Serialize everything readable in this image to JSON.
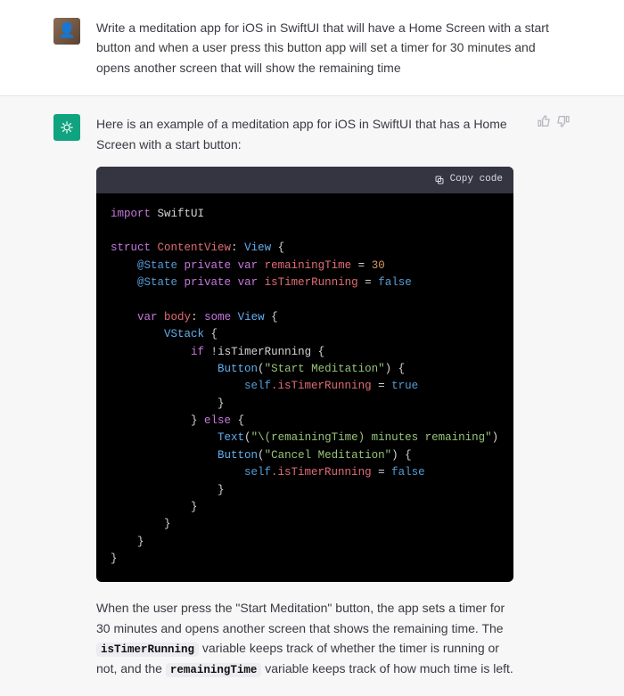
{
  "user": {
    "prompt": "Write a meditation app for iOS in SwiftUI that will have a Home Screen with a start button and when a user press this button app will set a timer for 30 minutes and opens another screen that will show the remaining time"
  },
  "assistant": {
    "intro": "Here is an example of a meditation app for iOS in SwiftUI that has a Home Screen with a start button:",
    "code_header": {
      "copy_label": "Copy code"
    },
    "code": {
      "kw_import": "import",
      "mod_swiftui": "SwiftUI",
      "kw_struct": "struct",
      "type_contentview": "ContentView",
      "type_view": "View",
      "attr_state": "@State",
      "kw_private": "private",
      "kw_var": "var",
      "var_remaining": "remainingTime",
      "num_30": "30",
      "var_running": "isTimerRunning",
      "bool_false": "false",
      "bool_true": "true",
      "var_body": "body",
      "kw_some": "some",
      "type_vstack": "VStack",
      "kw_if": "if",
      "kw_else": "else",
      "type_button": "Button",
      "str_start": "\"Start Meditation\"",
      "str_cancel": "\"Cancel Meditation\"",
      "type_text": "Text",
      "str_remaining": "\"\\(remainingTime) minutes remaining\"",
      "kw_self": "self",
      "dot_running": ".isTimerRunning"
    },
    "outro": {
      "p1a": "When the user press the \"Start Meditation\" button, the app sets a timer for 30 minutes and opens another screen that shows the remaining time. The ",
      "c1": "isTimerRunning",
      "p1b": " variable keeps track of whether the timer is running or not, and the ",
      "c2": "remainingTime",
      "p1c": " variable keeps track of how much time is left."
    }
  },
  "icons": {
    "thumb_up": "thumb-up-icon",
    "thumb_down": "thumb-down-icon",
    "copy": "copy-icon"
  }
}
